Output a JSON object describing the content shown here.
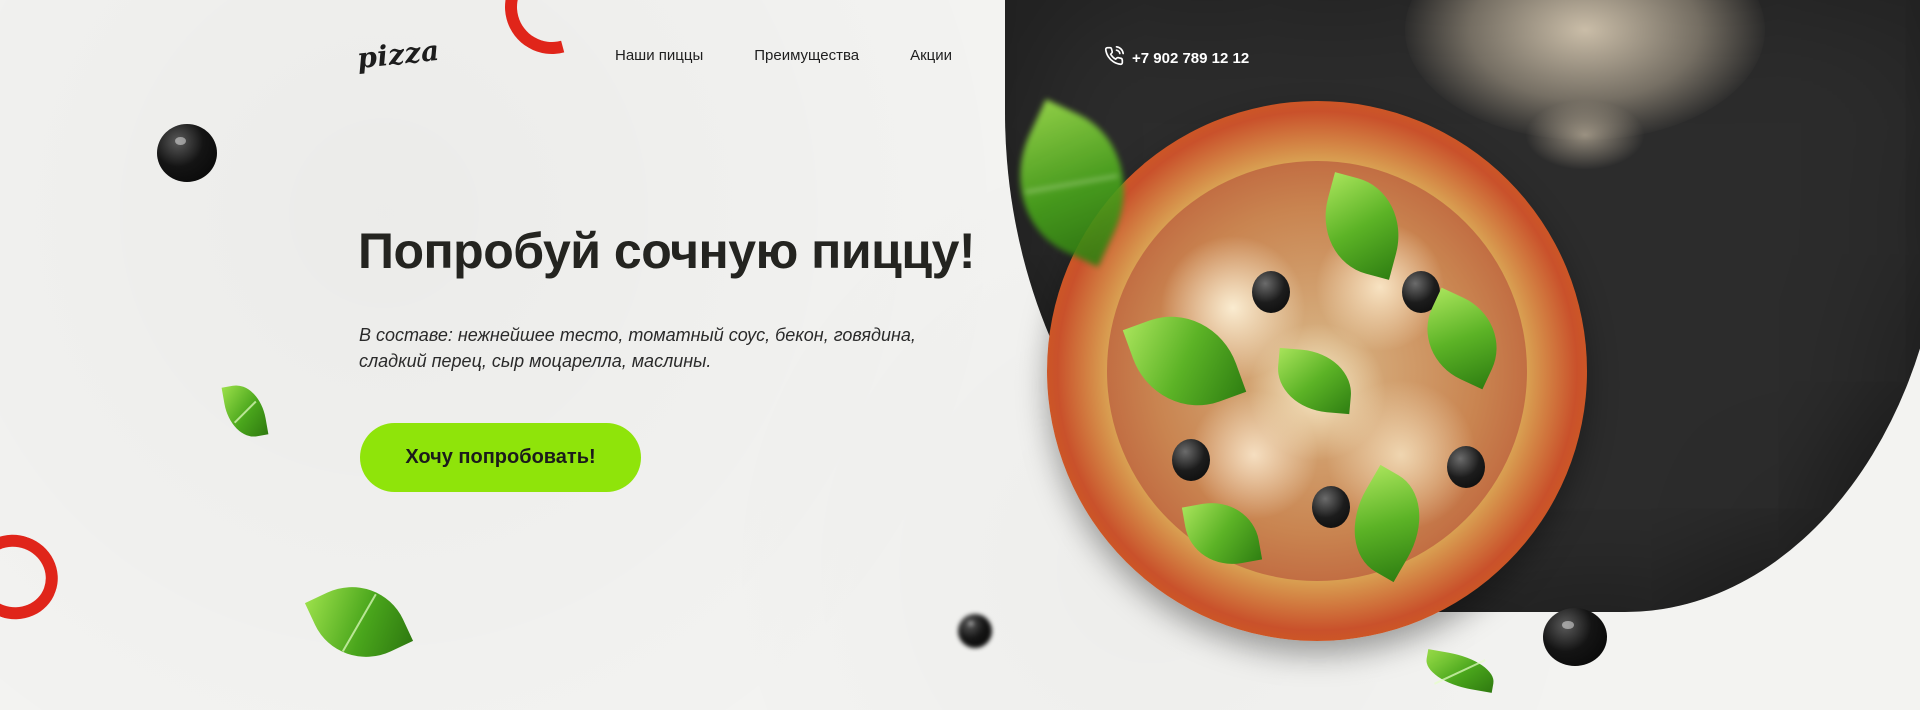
{
  "header": {
    "logo_text": "pizza",
    "nav": [
      {
        "label": "Наши пиццы"
      },
      {
        "label": "Преимущества"
      },
      {
        "label": "Акции"
      }
    ],
    "phone": {
      "icon": "phone-icon",
      "number": "+7 902 789 12 12"
    }
  },
  "hero": {
    "title": "Попробуй сочную пиццу!",
    "description": "В составе: нежнейшее тесто, томатный соус, бекон, говядина, сладкий перец, сыр моцарелла, маслины.",
    "cta_label": "Хочу попробовать!"
  },
  "colors": {
    "accent": "#8fe40a",
    "dark_background": "#2c2c2c",
    "page_background": "#f3f3f1",
    "text": "#242420"
  }
}
